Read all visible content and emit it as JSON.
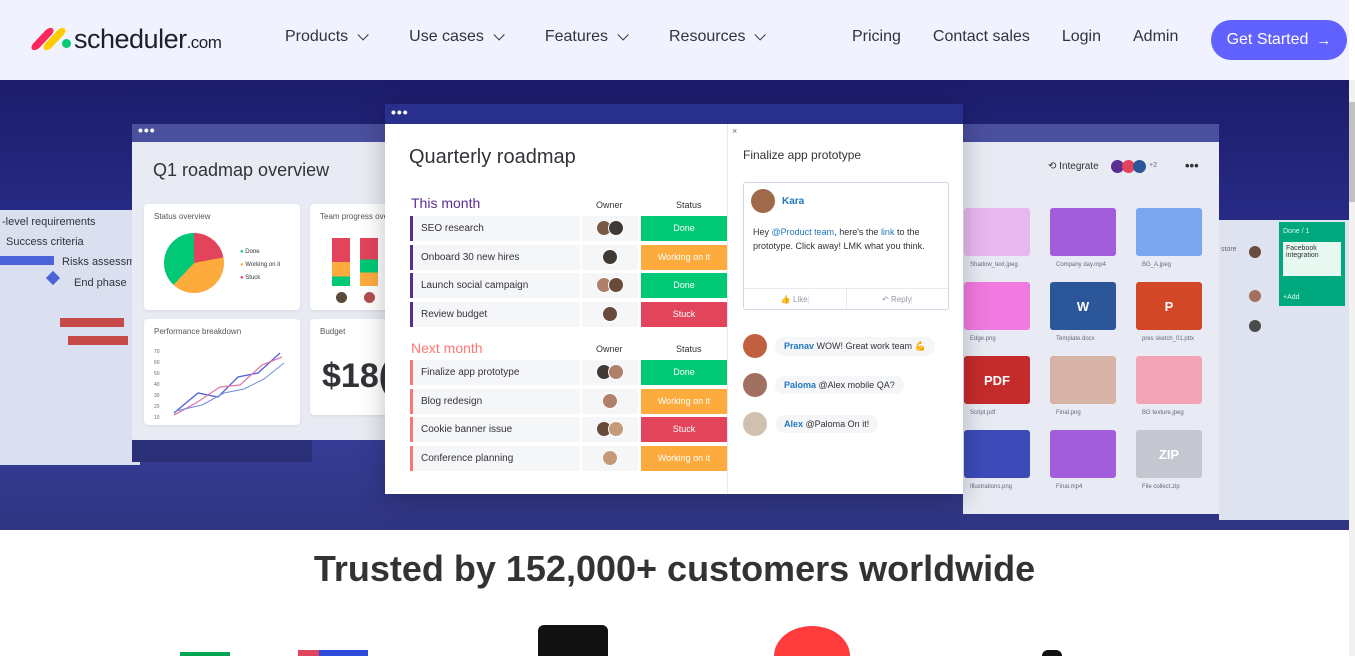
{
  "brand": {
    "name": "scheduler",
    "suffix": ".com"
  },
  "nav": {
    "items": [
      {
        "label": "Products"
      },
      {
        "label": "Use cases"
      },
      {
        "label": "Features"
      },
      {
        "label": "Resources"
      }
    ],
    "right": [
      {
        "label": "Pricing"
      },
      {
        "label": "Contact sales"
      },
      {
        "label": "Login"
      },
      {
        "label": "Admin"
      }
    ],
    "cta": "Get Started"
  },
  "hero": {
    "left_board": {
      "title": "Q1 roadmap overview",
      "widgets": {
        "status_overview": "Status overview",
        "team_progress": "Team progress ove",
        "performance": "Performance breakdown",
        "budget": "Budget",
        "budget_value": "$18("
      },
      "legend": [
        "Done",
        "Working on it",
        "Stuck"
      ],
      "gantt": [
        "-level requirements",
        "Success criteria",
        "Risks assessm",
        "End phase"
      ],
      "perf_ticks": [
        "70",
        "60",
        "50",
        "40",
        "30",
        "20",
        "10"
      ]
    },
    "roadmap": {
      "title": "Quarterly roadmap",
      "groups": [
        {
          "title": "This month",
          "owner_label": "Owner",
          "status_label": "Status",
          "rows": [
            {
              "name": "SEO research",
              "status": "Done"
            },
            {
              "name": "Onboard 30 new hires",
              "status": "Working on it"
            },
            {
              "name": "Launch social campaign",
              "status": "Done"
            },
            {
              "name": "Review budget",
              "status": "Stuck"
            }
          ]
        },
        {
          "title": "Next month",
          "owner_label": "Owner",
          "status_label": "Status",
          "rows": [
            {
              "name": "Finalize app prototype",
              "status": "Done"
            },
            {
              "name": "Blog redesign",
              "status": "Working on it"
            },
            {
              "name": "Cookie banner issue",
              "status": "Stuck"
            },
            {
              "name": "Conference planning",
              "status": "Working on it"
            }
          ]
        }
      ]
    },
    "item_panel": {
      "title": "Finalize app prototype",
      "comment": {
        "author": "Kara",
        "prefix": "Hey ",
        "mention": "@Product team",
        "middle": ", here's the ",
        "link": "link",
        "suffix": " to the prototype. Click away! LMK what you think.",
        "like": "Like",
        "reply": "Reply"
      },
      "replies": [
        {
          "author": "Pranav",
          "text": "WOW! Great work team 💪"
        },
        {
          "author": "Paloma",
          "text": "@Alex mobile QA?"
        },
        {
          "author": "Alex",
          "text": "@Paloma On it!"
        }
      ]
    },
    "files_board": {
      "integrate": "Integrate",
      "integrate_count": "+2",
      "tiles": [
        {
          "label": "",
          "caption": "Shadow_text.jpeg",
          "color": "#e9b7f0"
        },
        {
          "label": "",
          "caption": "Company day.mp4",
          "color": "#a25ddc"
        },
        {
          "label": "",
          "caption": "BG_A.jpeg",
          "color": "#7aa6f0"
        },
        {
          "label": "",
          "caption": "Edge.png",
          "color": "#f07ae0"
        },
        {
          "label": "W",
          "caption": "Template.docx",
          "color": "#2b579a"
        },
        {
          "label": "P",
          "caption": "pres sketch_01.pttx",
          "color": "#d24726"
        },
        {
          "label": "PDF",
          "caption": "Script.pdf",
          "color": "#c42b2b"
        },
        {
          "label": "",
          "caption": "Final.png",
          "color": "#d6b3a6"
        },
        {
          "label": "",
          "caption": "BG texture.jpeg",
          "color": "#f3a3b6"
        },
        {
          "label": "",
          "caption": "Illustrations.png",
          "color": "#3c4bb8"
        },
        {
          "label": "",
          "caption": "Final.mp4",
          "color": "#a25ddc"
        },
        {
          "label": "ZIP",
          "caption": "File collect.zip",
          "color": "#c5c7d0"
        }
      ],
      "side_card": {
        "title": "Done / 1",
        "item": "Facebook integration",
        "add": "+Add"
      },
      "store": "store"
    }
  },
  "trusted": {
    "headline": "Trusted by 152,000+ customers worldwide"
  },
  "colors": {
    "accent": "#6161ff",
    "done": "#00c875",
    "working": "#fdab3d",
    "stuck": "#e2445c",
    "this_month": "#5a2d91",
    "next_month": "#ff7575"
  }
}
